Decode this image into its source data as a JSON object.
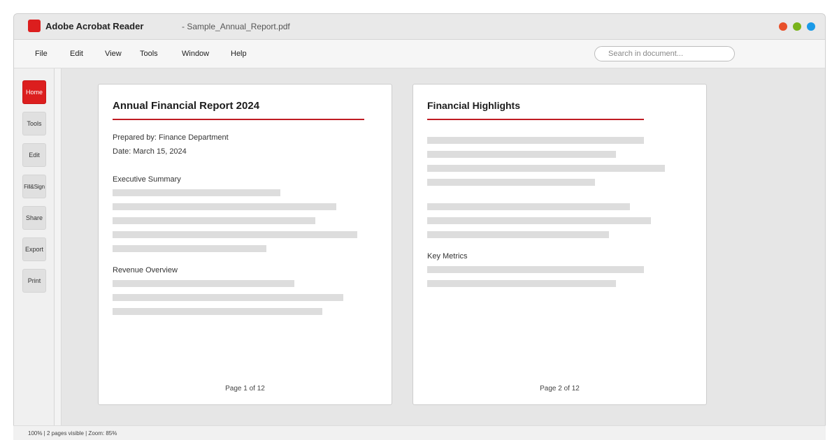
{
  "titlebar": {
    "app_name": "Adobe Acrobat Reader",
    "doc_title": "- Sample_Annual_Report.pdf",
    "brand_color": "#dc1e1e",
    "window_controls": {
      "close_color": "#e8502a",
      "minimize_color": "#79b31a",
      "maximize_color": "#1a9ae8"
    }
  },
  "menu": {
    "items": [
      "File",
      "Edit",
      "View",
      "Tools",
      "Window",
      "Help"
    ]
  },
  "search": {
    "placeholder": "Search in document...",
    "value": ""
  },
  "sidebar": {
    "items": [
      {
        "label": "Home",
        "active": true
      },
      {
        "label": "Tools",
        "active": false
      },
      {
        "label": "Edit",
        "active": false
      },
      {
        "label": "Fill&Sign",
        "active": false
      },
      {
        "label": "Share",
        "active": false
      },
      {
        "label": "Export",
        "active": false
      },
      {
        "label": "Print",
        "active": false
      }
    ]
  },
  "pages": [
    {
      "heading": "Annual Financial Report 2024",
      "prepared_by": "Prepared by: Finance Department",
      "date": "Date: March 15, 2024",
      "sections": [
        "Executive Summary",
        "Revenue Overview"
      ],
      "footer": "Page 1 of 12"
    },
    {
      "heading": "Financial Highlights",
      "sections": [
        "Key Metrics"
      ],
      "footer": "Page 2 of 12"
    }
  ],
  "status": {
    "text": "100% | 2 pages visible | Zoom: 85%"
  }
}
